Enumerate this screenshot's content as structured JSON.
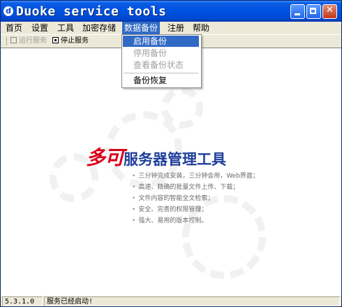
{
  "window": {
    "title": "Duoke service tools",
    "icon": "app-icon",
    "controls": {
      "minimize": "minimize-icon",
      "maximize": "maximize-icon",
      "close_label": "✕"
    }
  },
  "menubar": {
    "items": [
      "首页",
      "设置",
      "工具",
      "加密存储",
      "数据备份",
      "注册",
      "帮助"
    ],
    "active": "数据备份"
  },
  "toolbar": {
    "run_label": "运行服务",
    "stop_label": "停止服务"
  },
  "dropdown": {
    "items": [
      {
        "label": "启用备份",
        "state": "highlighted"
      },
      {
        "label": "停用备份",
        "state": "disabled"
      },
      {
        "label": "查看备份状态",
        "state": "disabled"
      },
      {
        "label": "备份恢复",
        "state": "enabled"
      }
    ]
  },
  "splash": {
    "logo_brand": "多可",
    "logo_text": "服务器管理工具",
    "features": [
      "三分钟完成安装，三分钟会用，Web界面；",
      "高速、精确的批量文件上传、下载；",
      "文件内容的智能全文检索；",
      "安全、完善的权限管理；",
      "强大、易用的版本控制。"
    ],
    "colors": {
      "brand": "#d8001a",
      "text": "#1e3e9a"
    }
  },
  "statusbar": {
    "version": "5.3.1.0",
    "message": "服务已经启动!"
  }
}
